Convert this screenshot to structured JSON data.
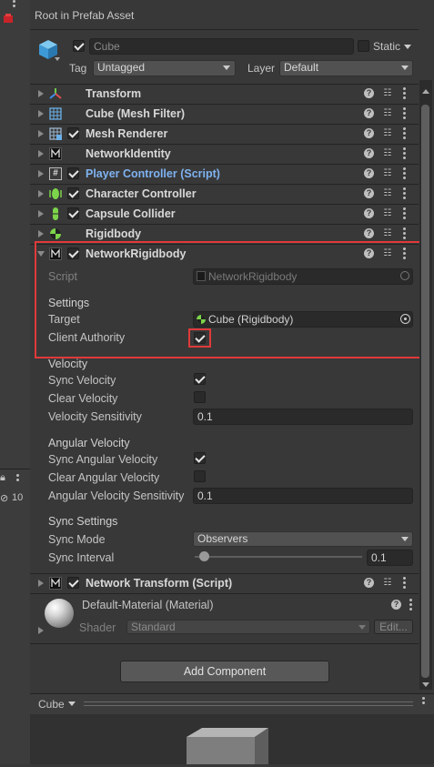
{
  "header": {
    "title": "Root in Prefab Asset"
  },
  "object": {
    "name_placeholder": "Cube",
    "static_label": "Static",
    "tag_label": "Tag",
    "tag_value": "Untagged",
    "layer_label": "Layer",
    "layer_value": "Default"
  },
  "components": [
    {
      "name": "Transform"
    },
    {
      "name": "Cube (Mesh Filter)"
    },
    {
      "name": "Mesh Renderer"
    },
    {
      "name": "NetworkIdentity"
    },
    {
      "name": "Player Controller (Script)"
    },
    {
      "name": "Character Controller"
    },
    {
      "name": "Capsule Collider"
    },
    {
      "name": "Rigidbody"
    },
    {
      "name": "NetworkRigidbody"
    }
  ],
  "network_rigidbody": {
    "script_label": "Script",
    "script_value": "NetworkRigidbody",
    "settings_header": "Settings",
    "target_label": "Target",
    "target_value": "Cube (Rigidbody)",
    "client_authority_label": "Client Authority",
    "velocity_header": "Velocity",
    "sync_velocity_label": "Sync Velocity",
    "clear_velocity_label": "Clear Velocity",
    "velocity_sensitivity_label": "Velocity Sensitivity",
    "velocity_sensitivity_value": "0.1",
    "angular_header": "Angular Velocity",
    "sync_angular_label": "Sync Angular Velocity",
    "clear_angular_label": "Clear Angular Velocity",
    "angular_sensitivity_label": "Angular Velocity Sensitivity",
    "angular_sensitivity_value": "0.1",
    "sync_settings_header": "Sync Settings",
    "sync_mode_label": "Sync Mode",
    "sync_mode_value": "Observers",
    "sync_interval_label": "Sync Interval",
    "sync_interval_value": "0.1"
  },
  "network_transform": {
    "name": "Network Transform (Script)"
  },
  "material": {
    "name": "Default-Material (Material)",
    "shader_label": "Shader",
    "shader_value": "Standard",
    "edit_label": "Edit..."
  },
  "add_component_label": "Add Component",
  "preview": {
    "label": "Cube"
  },
  "left_panel": {
    "count": "10"
  },
  "colors": {
    "accent_link": "#7fb2f0",
    "highlight_red": "#e03a3a"
  }
}
